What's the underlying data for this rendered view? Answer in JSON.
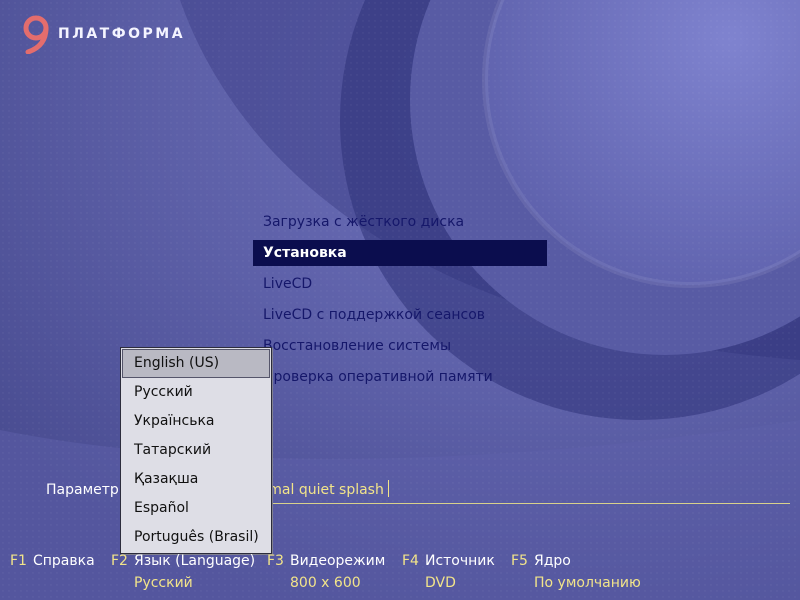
{
  "brand": {
    "logo_text": "ПЛАТФОРМА"
  },
  "colors": {
    "background": "#5b5ea6",
    "menu_text": "#15176a",
    "menu_selected_bg": "#0b0d4e",
    "accent_yellow": "#f2e48a"
  },
  "boot_menu": {
    "items": [
      {
        "label": "Загрузка с жёсткого диска",
        "selected": false
      },
      {
        "label": "Установка",
        "selected": true
      },
      {
        "label": "LiveCD",
        "selected": false
      },
      {
        "label": "LiveCD с поддержкой сеансов",
        "selected": false
      },
      {
        "label": "Восстановление системы",
        "selected": false
      },
      {
        "label": "Проверка оперативной памяти",
        "selected": false
      }
    ]
  },
  "boot_params": {
    "label": "Параметры загрузки",
    "value": "vga=normal quiet splash"
  },
  "language_menu": {
    "items": [
      {
        "label": "English (US)",
        "selected": true
      },
      {
        "label": "Русский",
        "selected": false
      },
      {
        "label": "Українська",
        "selected": false
      },
      {
        "label": "Татарский",
        "selected": false
      },
      {
        "label": "Қазақша",
        "selected": false
      },
      {
        "label": "Español",
        "selected": false
      },
      {
        "label": "Português (Brasil)",
        "selected": false
      }
    ]
  },
  "function_keys": [
    {
      "key": "F1",
      "name": "Справка",
      "value": ""
    },
    {
      "key": "F2",
      "name": "Язык (Language)",
      "value": "Русский"
    },
    {
      "key": "F3",
      "name": "Видеорежим",
      "value": "800 x 600"
    },
    {
      "key": "F4",
      "name": "Источник",
      "value": "DVD"
    },
    {
      "key": "F5",
      "name": "Ядро",
      "value": "По умолчанию"
    }
  ]
}
